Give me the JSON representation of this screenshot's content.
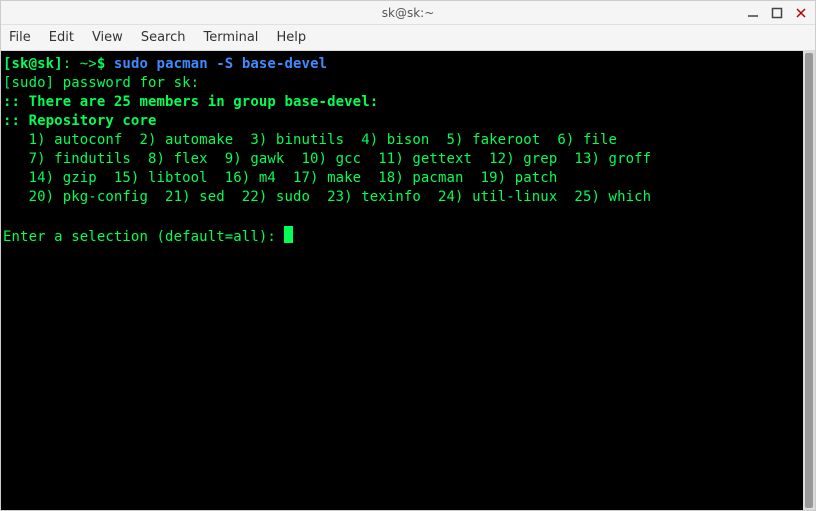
{
  "window": {
    "title": "sk@sk:~"
  },
  "menu": {
    "file": "File",
    "edit": "Edit",
    "view": "View",
    "search": "Search",
    "terminal": "Terminal",
    "help": "Help"
  },
  "prompt": {
    "lbracket": "[",
    "user": "sk",
    "at": "@",
    "host": "sk",
    "rbracket": "]",
    "colon": ":",
    "cwd": " ~>",
    "dollar": "$ ",
    "command": "sudo pacman -S base-devel"
  },
  "lines": {
    "sudo_pw": "[sudo] password for sk: ",
    "members": ":: There are 25 members in group base-devel:",
    "repo": ":: Repository core",
    "row1": "   1) autoconf  2) automake  3) binutils  4) bison  5) fakeroot  6) file",
    "row2": "   7) findutils  8) flex  9) gawk  10) gcc  11) gettext  12) grep  13) groff",
    "row3": "   14) gzip  15) libtool  16) m4  17) make  18) pacman  19) patch",
    "row4": "   20) pkg-config  21) sed  22) sudo  23) texinfo  24) util-linux  25) which",
    "blank": "",
    "select": "Enter a selection (default=all): "
  }
}
